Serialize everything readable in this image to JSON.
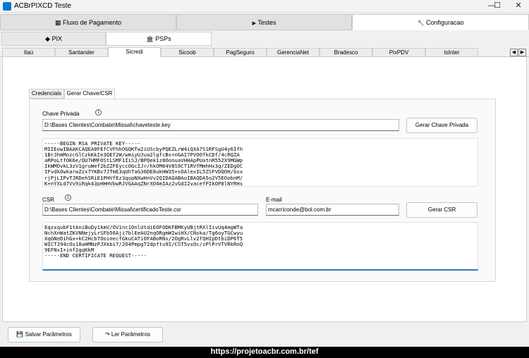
{
  "window": {
    "title": "ACBrPIXCD Teste",
    "min": "—",
    "max": "☐",
    "close": "✕"
  },
  "top_tabs": [
    {
      "label": "Fluxo de Pagamento",
      "icon": "grid-icon",
      "glyph": "▦"
    },
    {
      "label": "Testes",
      "icon": "play-icon",
      "glyph": "▶"
    },
    {
      "label": "Configuracao",
      "icon": "wrench-icon",
      "glyph": "🔧"
    }
  ],
  "sub_tabs": [
    {
      "label": "PIX",
      "icon": "diamond-icon",
      "glyph": "◆"
    },
    {
      "label": "PSPs",
      "icon": "bank-icon",
      "glyph": "🏛"
    }
  ],
  "psp_tabs": [
    "Itaú",
    "Santander",
    "Sicredi",
    "Sicoob",
    "PagSeguro",
    "GerenciaNet",
    "Bradesco",
    "PixPDV",
    "tsInter"
  ],
  "inner_tabs": [
    "Credenciais",
    "Gerar Chave/CSR"
  ],
  "form": {
    "chave_privada_label": "Chave Privada",
    "chave_privada_path": "D:\\Bases Clientes\\Combate\\Missal\\chaveteste.key",
    "gerar_chave_label": "Gerar Chave Privada",
    "private_key_text": "-----BEGIN RSA PRIVATE KEY-----\nMIIEowIBAAKCAQEA0FEfCVFhhOGQKTw2iUScbyPQEZLrW4iQXA7S1RFSgU4y6Ifh\n1BrJhmMozcGlCzkKkIe3QEf2W/wmiyUJua2lgfcBs+nGAI7PVOOfkCDf/4cRQZA\naRPoLtfOK6e/QU7HMFOStLSMF1IiSJ/BPQek1z8OonuaVHHApPUatnR552X9MGWp\nIkWMOvkL3zV1gruWef2bZZFEyccOGcIJr/hkOM84V8S9CT1RVfMmhHx3q/ZEDgOC\nIFvdkOwkarwZzx7YKBv7JTmE3qUhTaG36DE8ukHW35+sOAlexIL5ZSFVDQOH/bxx\nrjPjLIPvTJRDehSRiE1PHVfEz3qopNXwHnVv2QIDAQABAoIBAQDA5o2V5EOobnM/\nK+nYXLd7Vv9iRqk43pHHHVbwRJVGAAqZNrXO4mIAz2vGdI2vacefPIkOP8lNYRHs",
    "csr_label": "CSR",
    "csr_path": "D:\\Bases Clientes\\Combate\\Missal\\certificadoTeste.csr",
    "email_label": "E-mail",
    "email_value": "mcarriconde@bol.com.br",
    "gerar_csr_label": "Gerar CSR",
    "csr_text": "EqzxqubF1tAniBuDy1kmV/OV1nc1OnlUtdiEOFODKFBMKyUBjtRXlIivUq4mgWTa\nNchXnWatZKVNNejyLrSFb56Aji7blEeAU2nqORgmWIwiHX/CNska/Tg6oyTGCwyu\nXqGNeDihGx+kC2Hcb7OoinecfGkuCATiOFABoRNs/2OgRvLlv2fQHIpDtbiDP6T5\nWICTJ94cOs18aHMNzPJXkbi7/2O4PmpgT2dpftu9I/CST5vxOc/zPlPrVTVRkRnQ\n9EFNxI+inf2gqKkM\n-----END CERTIFICATE REQUEST-----"
  },
  "bottom": {
    "salvar_label": "Salvar Parâmetros",
    "ler_label": "Ler Parâmetros"
  },
  "footer_text": "https://projetoacbr.com.br/tef"
}
